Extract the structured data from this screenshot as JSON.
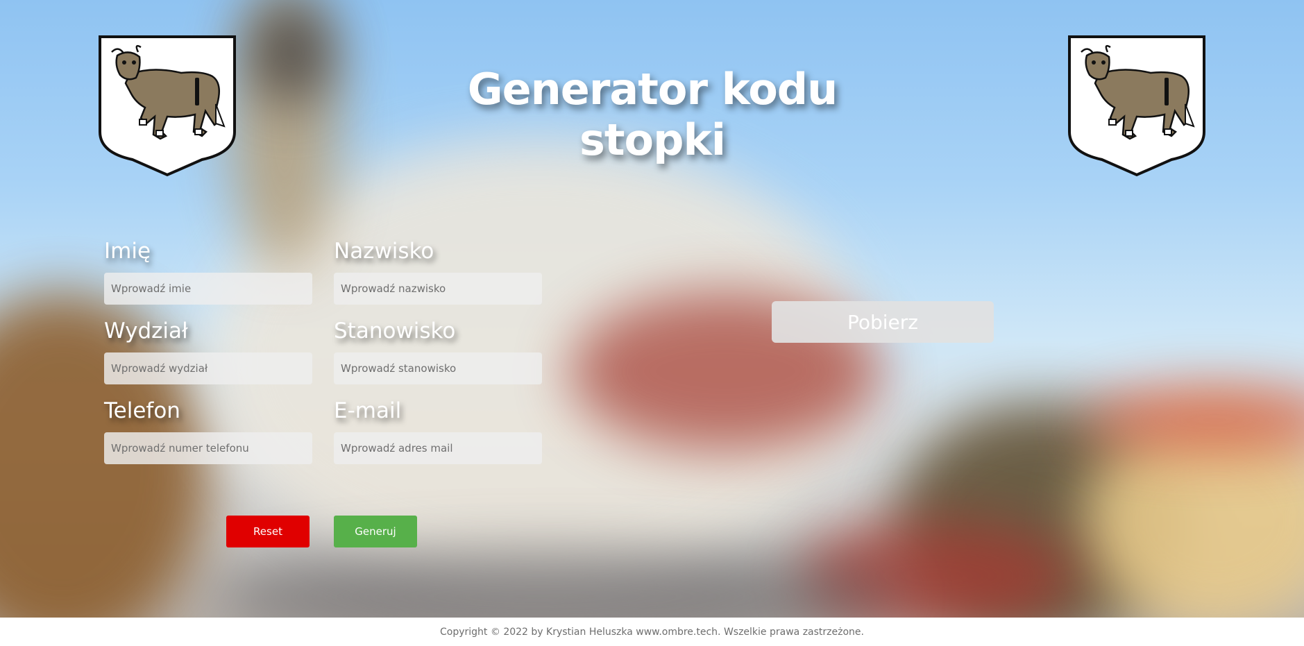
{
  "header": {
    "title": "Generator kodu stopki"
  },
  "form": {
    "first_name": {
      "label": "Imię",
      "placeholder": "Wprowadź imie"
    },
    "last_name": {
      "label": "Nazwisko",
      "placeholder": "Wprowadź nazwisko"
    },
    "department": {
      "label": "Wydział",
      "placeholder": "Wprowadź wydział"
    },
    "position": {
      "label": "Stanowisko",
      "placeholder": "Wprowadź stanowisko"
    },
    "phone": {
      "label": "Telefon",
      "placeholder": "Wprowadź numer telefonu"
    },
    "email": {
      "label": "E-mail",
      "placeholder": "Wprowadź adres mail"
    },
    "reset_label": "Reset",
    "generate_label": "Generuj"
  },
  "download": {
    "label": "Pobierz"
  },
  "footer": {
    "text": "Copyright © 2022 by Krystian Heluszka www.ombre.tech. Wszelkie prawa zastrzeżone."
  },
  "colors": {
    "reset": "#e00000",
    "generate": "#57b04a",
    "crest_bull": "#8b7a5e"
  },
  "icons": {
    "crest": "bull-coat-of-arms-icon"
  }
}
